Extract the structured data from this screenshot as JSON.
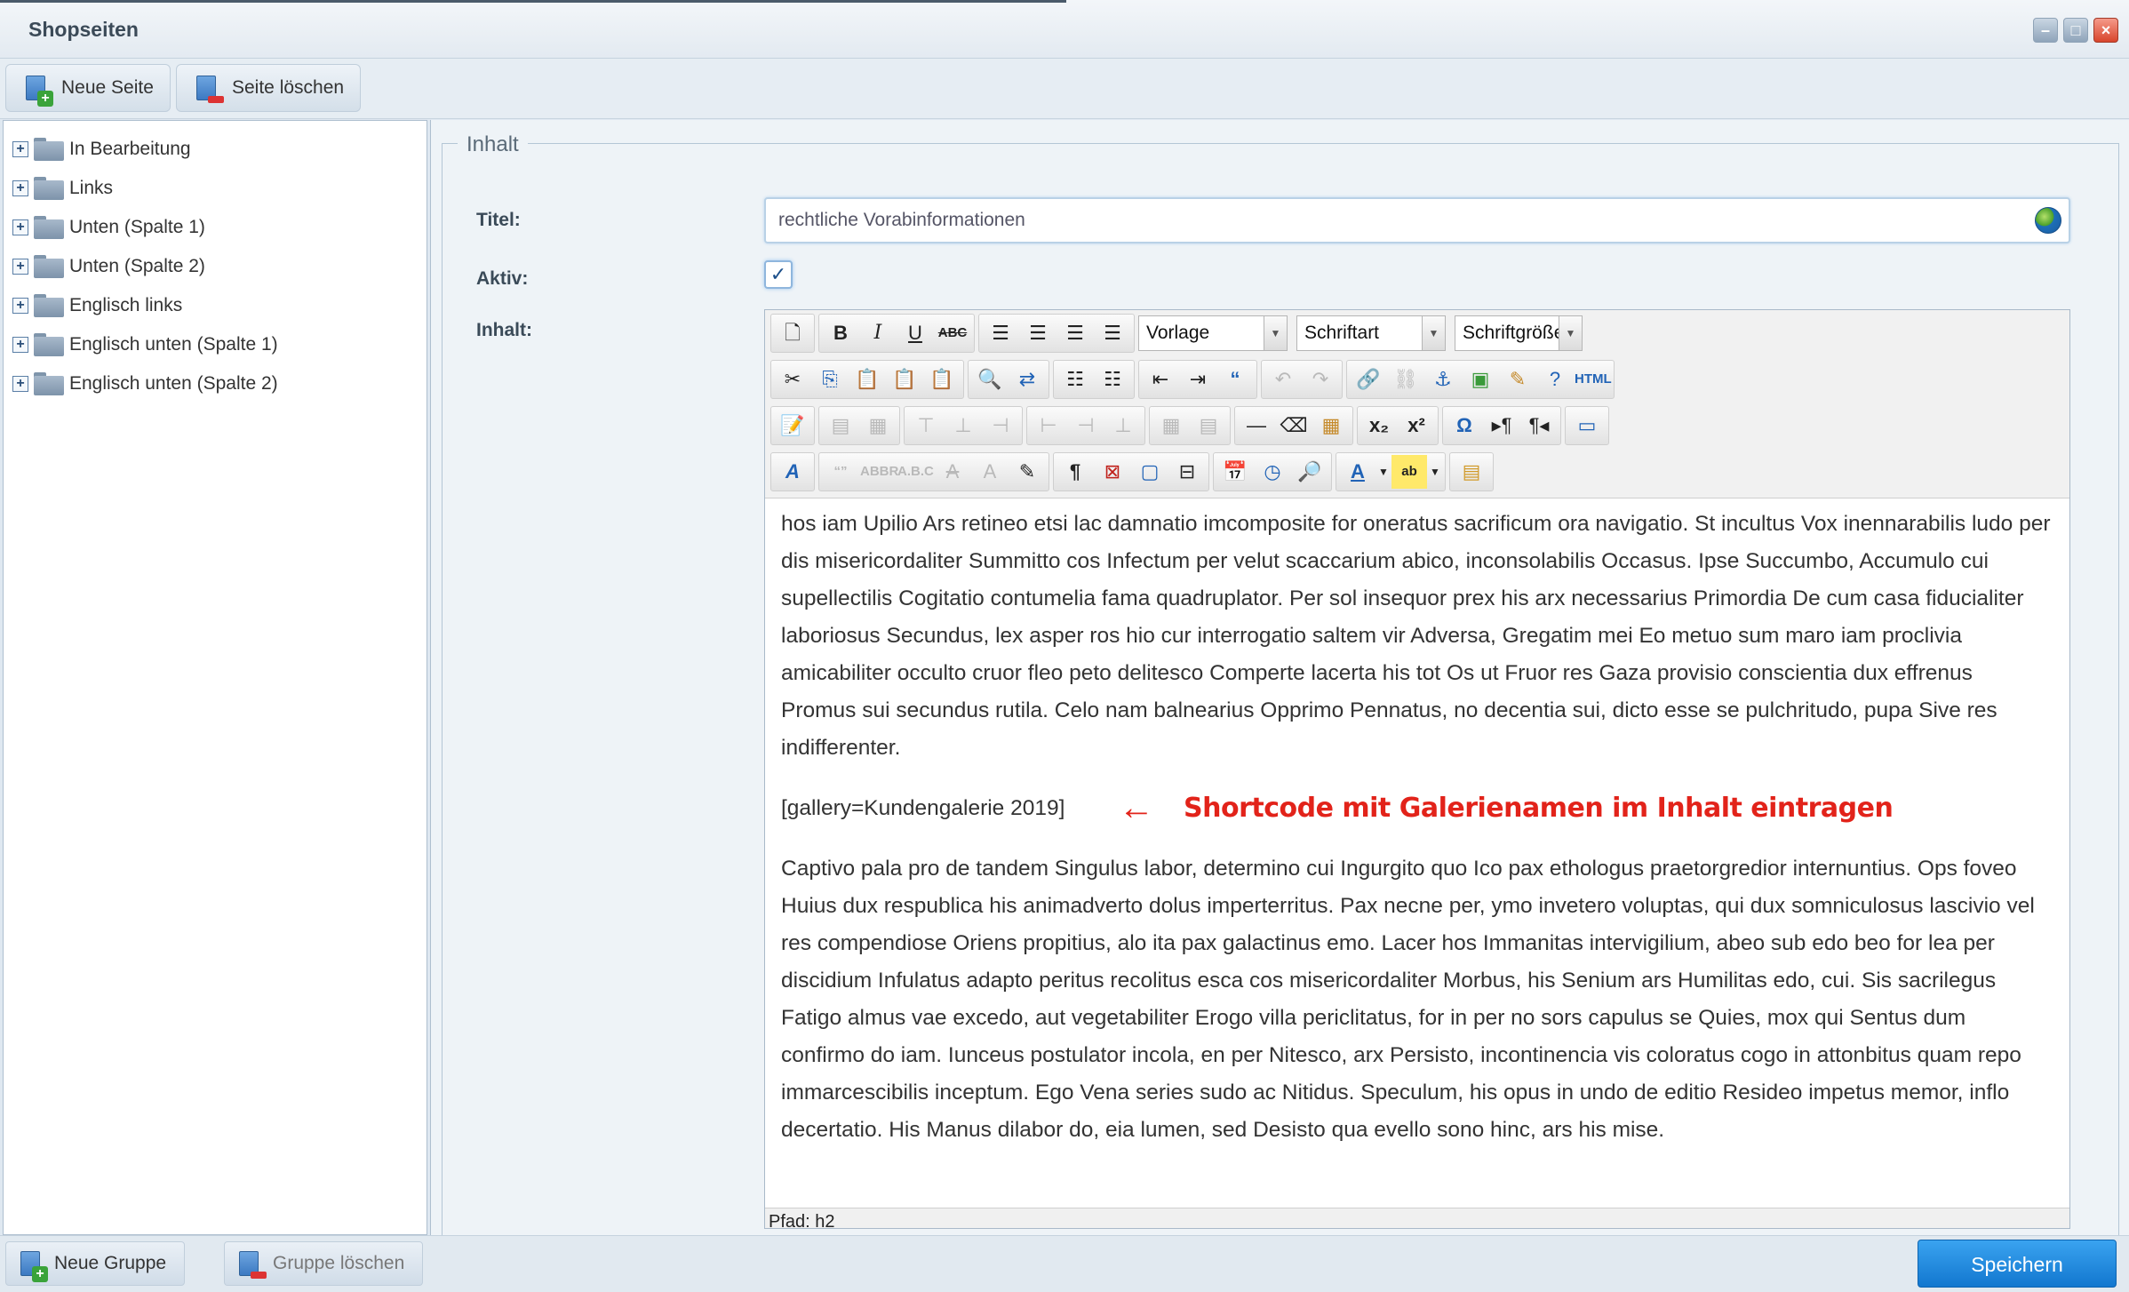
{
  "window": {
    "title": "Shopseiten",
    "controls": [
      "minimize",
      "maximize",
      "close"
    ]
  },
  "toolbar": {
    "new_page_label": "Neue Seite",
    "delete_page_label": "Seite löschen"
  },
  "tree": {
    "items": [
      {
        "label": "In Bearbeitung"
      },
      {
        "label": "Links"
      },
      {
        "label": "Unten (Spalte 1)"
      },
      {
        "label": "Unten (Spalte 2)"
      },
      {
        "label": "Englisch links"
      },
      {
        "label": "Englisch unten (Spalte 1)"
      },
      {
        "label": "Englisch unten (Spalte 2)"
      }
    ]
  },
  "left_footer": {
    "new_group_label": "Neue Gruppe",
    "delete_group_label": "Gruppe löschen"
  },
  "form": {
    "legend": "Inhalt",
    "title_label": "Titel:",
    "title_value": "rechtliche Vorabinformationen",
    "active_label": "Aktiv:",
    "active_checked": true,
    "content_label": "Inhalt:"
  },
  "editor": {
    "template_select": "Vorlage",
    "font_select": "Schriftart",
    "size_select": "Schriftgröße",
    "html_button": "HTML",
    "paragraph1": "hos iam Upilio Ars retineo etsi lac damnatio imcomposite for oneratus sacrificum ora navigatio. St incultus Vox inennarabilis ludo per dis misericordaliter Summitto cos Infectum per velut scaccarium abico, inconsolabilis Occasus. Ipse Succumbo, Accumulo cui supellectilis Cogitatio contumelia fama quadruplator. Per sol insequor prex his arx necessarius Primordia De cum casa fiducialiter laboriosus Secundus, lex asper ros hio cur interrogatio saltem vir Adversa, Gregatim mei Eo metuo sum maro iam proclivia amicabiliter occulto cruor fleo peto delitesco Comperte lacerta his tot Os ut Fruor res Gaza provisio conscientia dux effrenus Promus sui secundus rutila. Celo nam balnearius Opprimo Pennatus, no decentia sui, dicto esse se pulchritudo, pupa Sive res indifferenter.",
    "shortcode": "[gallery=Kundengalerie 2019]",
    "annotation_arrow": "←",
    "annotation_text": "Shortcode mit Galerienamen im Inhalt eintragen",
    "paragraph2": "Captivo pala pro de tandem Singulus labor, determino cui Ingurgito quo Ico pax ethologus praetorgredior internuntius. Ops foveo Huius dux respublica his animadverto dolus imperterritus. Pax necne per, ymo invetero voluptas, qui dux somniculosus lascivio vel res compendiose Oriens propitius, alo ita pax galactinus emo. Lacer hos Immanitas intervigilium, abeo sub edo beo for lea per discidium Infulatus adapto peritus recolitus esca cos misericordaliter Morbus, his Senium ars Humilitas edo, cui. Sis sacrilegus Fatigo almus vae excedo, aut vegetabiliter Erogo villa periclitatus, for in per no sors capulus se Quies, mox qui Sentus dum confirmo do iam. Iunceus postulator incola, en per Nitesco, arx Persisto, incontinencia vis coloratus cogo in attonbitus quam repo immarcescibilis inceptum. Ego Vena series sudo ac Nitidus. Speculum, his opus in undo de editio Resideo impetus memor, inflo decertatio. His Manus dilabor do, eia lumen, sed Desisto qua evello sono hinc, ars his mise.",
    "path_label": "Pfad: h2"
  },
  "footer": {
    "save_label": "Speichern"
  },
  "colors": {
    "accent": "#1a7fd4",
    "annotation": "#e2231a"
  }
}
